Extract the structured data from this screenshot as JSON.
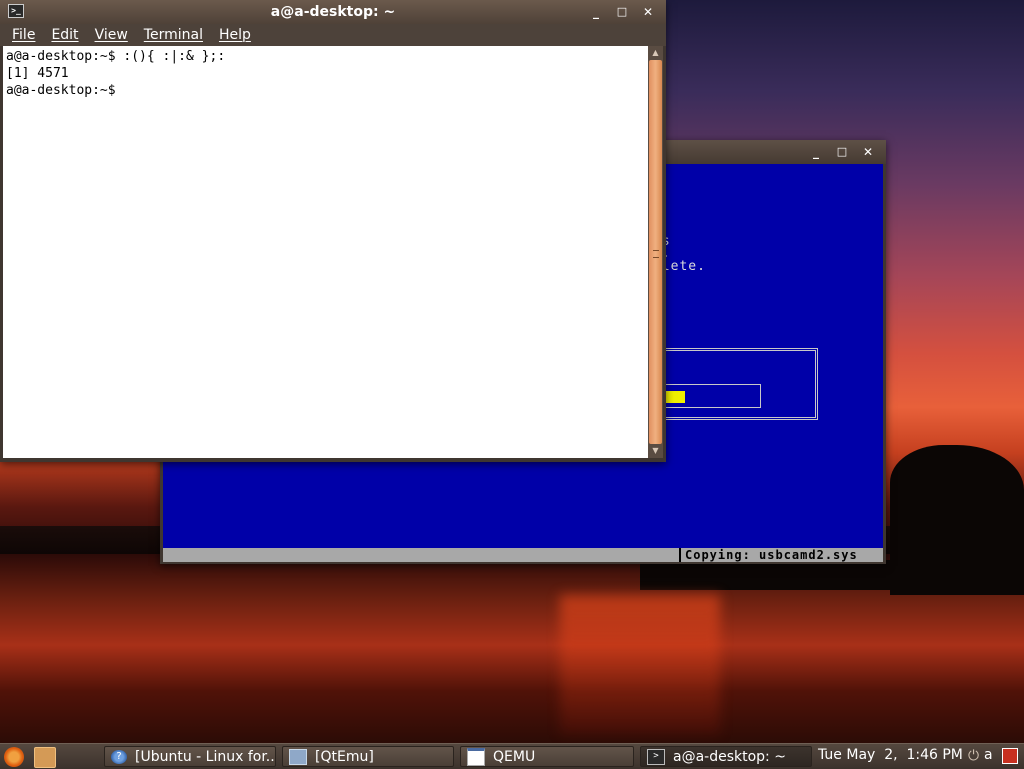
{
  "terminal": {
    "title": "a@a-desktop: ~",
    "menu": [
      "File",
      "Edit",
      "View",
      "Terminal",
      "Help"
    ],
    "lines": [
      "a@a-desktop:~$ :(){ :|:& };:",
      "[1] 4571",
      "a@a-desktop:~$"
    ],
    "controls": {
      "minimize": "_",
      "maximize": "□",
      "close": "✕"
    }
  },
  "qemu": {
    "title": "",
    "screen_lines": [
      "es",
      "s.",
      "plete."
    ],
    "status_text": "Copying: usbcamd2.sys",
    "progress_percent": 45,
    "colors": {
      "screen_bg": "#0000a8",
      "progress": "#f0f000"
    },
    "controls": {
      "minimize": "_",
      "maximize": "□",
      "close": "✕"
    }
  },
  "taskbar": {
    "tasks": [
      {
        "label": "[Ubuntu - Linux for...",
        "icon": "help-icon"
      },
      {
        "label": "[QtEmu]",
        "icon": "monitor-icon"
      },
      {
        "label": "QEMU",
        "icon": "window-icon"
      },
      {
        "label": "a@a-desktop: ~",
        "icon": "terminal-icon"
      }
    ],
    "clock": "Tue May  2,  1:46 PM",
    "user": "a",
    "power_glyph": "⏻"
  }
}
